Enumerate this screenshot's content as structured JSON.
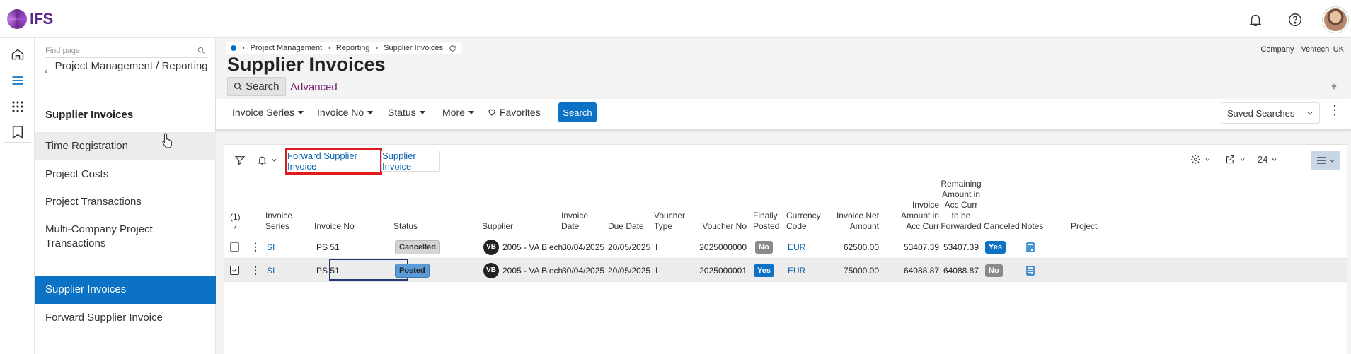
{
  "topbar": {
    "logo_text": "IFS",
    "icons": [
      "bell-icon",
      "help-icon",
      "user-avatar"
    ]
  },
  "rail": {
    "icons": [
      "home-icon",
      "menu-icon",
      "apps-grid-icon",
      "bookmark-icon"
    ]
  },
  "nav": {
    "find_placeholder": "Find page",
    "back_label": "Project Management / Reporting",
    "section_title": "Supplier Invoices",
    "items": [
      {
        "label": "Time Registration"
      },
      {
        "label": "Project Costs"
      },
      {
        "label": "Project Transactions"
      },
      {
        "label": "Multi-Company Project Transactions"
      },
      {
        "label": "Supplier Invoices"
      },
      {
        "label": "Forward Supplier Invoice"
      }
    ]
  },
  "breadcrumb": {
    "items": [
      "Project Management",
      "Reporting",
      "Supplier Invoices"
    ]
  },
  "company": {
    "label": "Company",
    "value": "Ventechi UK"
  },
  "page": {
    "title": "Supplier Invoices"
  },
  "search": {
    "search_tab": "Search",
    "advanced_tab": "Advanced",
    "filters": [
      "Invoice Series",
      "Invoice No",
      "Status",
      "More"
    ],
    "favorites": "Favorites",
    "search_button": "Search",
    "saved_searches": "Saved Searches"
  },
  "commands": {
    "forward": "Forward Supplier Invoice",
    "supplier_invoice": "Supplier Invoice",
    "page_size": "24"
  },
  "table": {
    "selected_count": "(1)",
    "columns": {
      "series": "Invoice Series",
      "invno": "Invoice No",
      "status": "Status",
      "supplier": "Supplier",
      "invdate": "Invoice Date",
      "duedate": "Due Date",
      "vtype": "Voucher Type",
      "vno": "Voucher No",
      "fposted": "Finally Posted",
      "currency": "Currency Code",
      "net": "Invoice Net Amount",
      "acc": "Invoice Amount in Acc Curr",
      "remaining": "Remaining Amount in Acc Curr to be Forwarded",
      "canceled": "Canceled",
      "notes": "Notes",
      "project": "Project"
    },
    "rows": [
      {
        "series": "SI",
        "invno": "PS 51",
        "status": "Cancelled",
        "supplier_initials": "VB",
        "supplier": "2005 - VA Blech",
        "invdate": "30/04/2025",
        "duedate": "20/05/2025",
        "vtype": "I",
        "vno": "2025000000",
        "fposted": "No",
        "currency": "EUR",
        "net": "62500.00",
        "acc": "53407.39",
        "remaining": "53407.39",
        "canceled": "Yes"
      },
      {
        "series": "SI",
        "invno": "PS 51",
        "status": "Posted",
        "supplier_initials": "VB",
        "supplier": "2005 - VA Blech",
        "invdate": "30/04/2025",
        "duedate": "20/05/2025",
        "vtype": "I",
        "vno": "2025000001",
        "fposted": "Yes",
        "currency": "EUR",
        "net": "75000.00",
        "acc": "64088.87",
        "remaining": "64088.87",
        "canceled": "No"
      }
    ]
  }
}
